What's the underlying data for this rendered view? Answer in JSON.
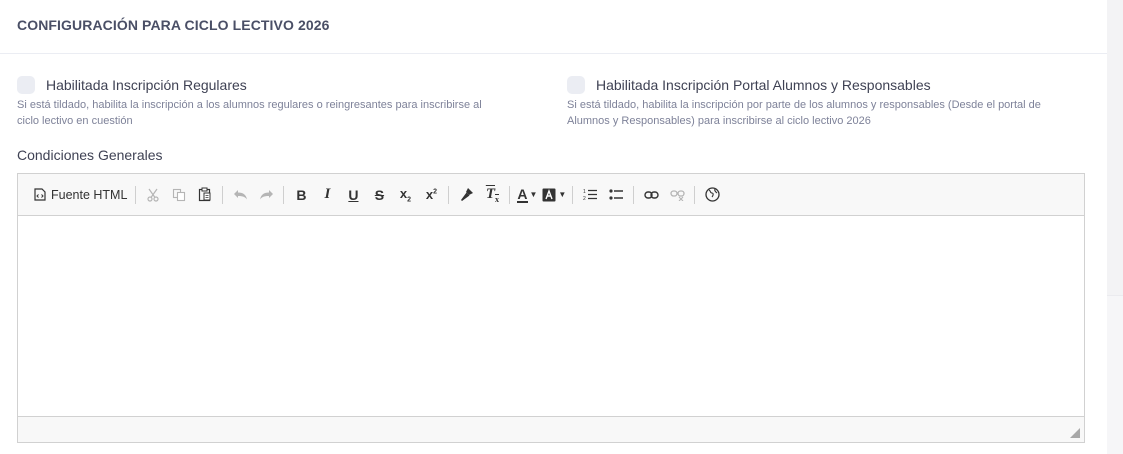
{
  "card": {
    "title": "CONFIGURACIÓN PARA CICLO LECTIVO 2026"
  },
  "options": {
    "regulares": {
      "label": "Habilitada Inscripción Regulares",
      "hint_line1": "Si está tildado, habilita la inscripción a los alumnos regulares o reingresantes para inscribirse al",
      "hint_line2": "ciclo lectivo en cuestión",
      "checked": false
    },
    "portal": {
      "label": "Habilitada Inscripción Portal Alumnos y Responsables",
      "hint_line1": "Si está tildado, habilita la inscripción por parte de los alumnos y responsables (Desde el portal de",
      "hint_line2": "Alumnos y Responsables) para inscribirse al ciclo lectivo 2026",
      "checked": false
    }
  },
  "editor": {
    "label": "Condiciones Generales",
    "source_button": "Fuente HTML",
    "content": "",
    "toolbar_icons": [
      "source-icon",
      "cut-icon",
      "copy-icon",
      "paste-icon",
      "undo-icon",
      "redo-icon",
      "bold-icon",
      "italic-icon",
      "underline-icon",
      "strikethrough-icon",
      "subscript-icon",
      "superscript-icon",
      "copy-format-icon",
      "remove-format-icon",
      "text-color-icon",
      "background-color-icon",
      "numbered-list-icon",
      "bulleted-list-icon",
      "link-icon",
      "unlink-icon",
      "language-icon"
    ]
  },
  "colors": {
    "title": "#4a4f66",
    "checkbox_bg": "#ebedf3",
    "hint": "#7e8299",
    "toolbar_bg": "#f8f8f8",
    "border": "#d1d1d1"
  }
}
